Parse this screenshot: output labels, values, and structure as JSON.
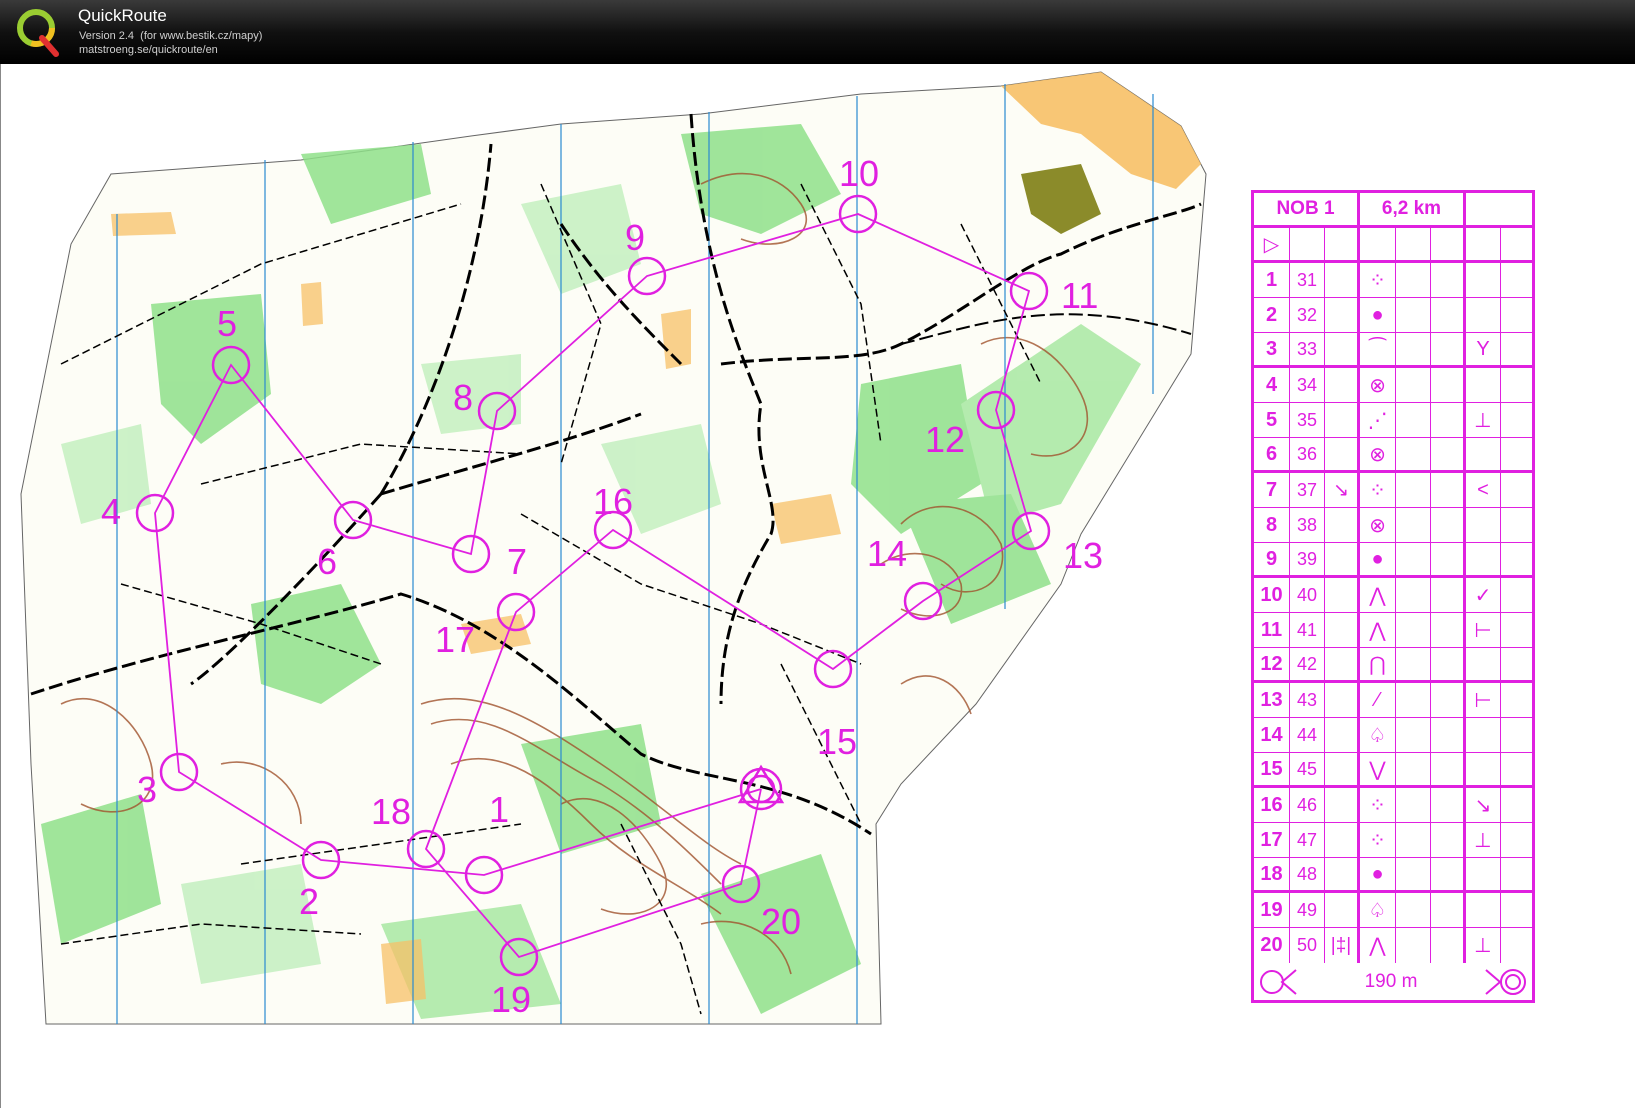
{
  "app": {
    "title": "QuickRoute",
    "version": "Version 2.4  (for www.bestik.cz/mapy)",
    "url": "matstroeng.se/quickroute/en",
    "logo_letter": "Q"
  },
  "colors": {
    "course": "#e020e0",
    "forest_green": "#7ddc7a",
    "light_green": "#c4f0c0",
    "open_land": "#f7c067",
    "contour": "#a0522d",
    "magnetic_north": "#2a8ad0",
    "track": "#000000"
  },
  "course": {
    "name": "NOB 1",
    "length": "6,2 km",
    "controls": [
      {
        "n": "1",
        "code": "31",
        "c": "",
        "d": "ditch-icon",
        "g": ""
      },
      {
        "n": "2",
        "code": "32",
        "c": "",
        "d": "dot-icon",
        "g": ""
      },
      {
        "n": "3",
        "code": "33",
        "c": "",
        "d": "rootstock-icon",
        "g": "Y"
      },
      {
        "n": "4",
        "code": "34",
        "c": "",
        "d": "crossing-icon",
        "g": ""
      },
      {
        "n": "5",
        "code": "35",
        "c": "",
        "d": "path-icon",
        "g": "⊥"
      },
      {
        "n": "6",
        "code": "36",
        "c": "",
        "d": "crossing-icon",
        "g": ""
      },
      {
        "n": "7",
        "code": "37",
        "c": "↘",
        "d": "ditch-icon",
        "g": "<"
      },
      {
        "n": "8",
        "code": "38",
        "c": "",
        "d": "crossing-icon",
        "g": ""
      },
      {
        "n": "9",
        "code": "39",
        "c": "",
        "d": "dot-icon",
        "g": ""
      },
      {
        "n": "10",
        "code": "40",
        "c": "",
        "d": "spur-icon",
        "g": "✓"
      },
      {
        "n": "11",
        "code": "41",
        "c": "",
        "d": "spur-icon",
        "g": "⊢"
      },
      {
        "n": "12",
        "code": "42",
        "c": "",
        "d": "knoll-icon",
        "g": ""
      },
      {
        "n": "13",
        "code": "43",
        "c": "",
        "d": "slash-icon",
        "g": "⊢"
      },
      {
        "n": "14",
        "code": "44",
        "c": "",
        "d": "tree-icon",
        "g": ""
      },
      {
        "n": "15",
        "code": "45",
        "c": "",
        "d": "reentrant-icon",
        "g": ""
      },
      {
        "n": "16",
        "code": "46",
        "c": "",
        "d": "ditch-icon",
        "g": "↘"
      },
      {
        "n": "17",
        "code": "47",
        "c": "",
        "d": "ditch-icon",
        "g": "⊥"
      },
      {
        "n": "18",
        "code": "48",
        "c": "",
        "d": "dot-icon",
        "g": ""
      },
      {
        "n": "19",
        "code": "49",
        "c": "",
        "d": "tree-icon",
        "g": ""
      },
      {
        "n": "20",
        "code": "50",
        "c": "|‡|",
        "d": "spur-icon",
        "g": "⊥"
      }
    ],
    "finish_distance": "190 m"
  },
  "map_controls": [
    {
      "label": "1"
    },
    {
      "label": "2"
    },
    {
      "label": "3"
    },
    {
      "label": "4"
    },
    {
      "label": "5"
    },
    {
      "label": "6"
    },
    {
      "label": "7"
    },
    {
      "label": "8"
    },
    {
      "label": "9"
    },
    {
      "label": "10"
    },
    {
      "label": "11"
    },
    {
      "label": "12"
    },
    {
      "label": "13"
    },
    {
      "label": "14"
    },
    {
      "label": "15"
    },
    {
      "label": "16"
    },
    {
      "label": "17"
    },
    {
      "label": "18"
    },
    {
      "label": "19"
    },
    {
      "label": "20"
    }
  ],
  "symbols": {
    "ditch-icon": "⁘",
    "dot-icon": "●",
    "rootstock-icon": "⁀",
    "crossing-icon": "⊗",
    "path-icon": "⋰",
    "spur-icon": "⋀",
    "knoll-icon": "⋂",
    "slash-icon": "⁄",
    "tree-icon": "♤",
    "reentrant-icon": "⋁",
    "start-icon": "▷"
  }
}
